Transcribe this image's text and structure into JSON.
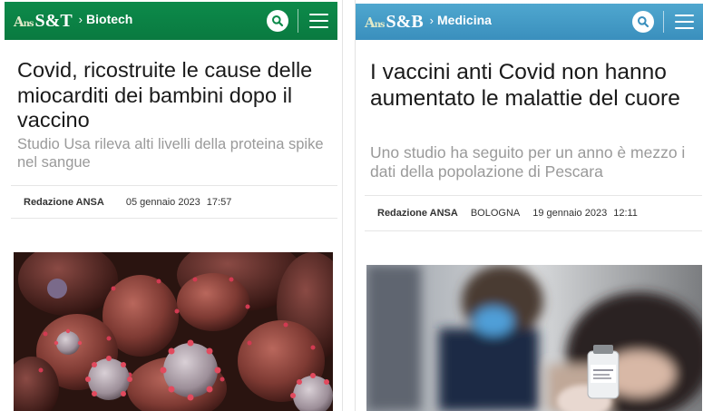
{
  "articles": [
    {
      "logo_mark": "ANSA",
      "logo_text": "S&T",
      "section": "Biotech",
      "headline": "Covid, ricostruite le cause delle miocarditi dei bambini dopo il vaccino",
      "subtitle": "Studio Usa rileva alti livelli della proteina spike nel sangue",
      "author": "Redazione ANSA",
      "location": "",
      "date": "05 gennaio 2023",
      "time": "17:57",
      "header_color": "#0c8a4a",
      "image_icon": "coronavirus-microscopy-image"
    },
    {
      "logo_mark": "ANSA",
      "logo_text": "S&B",
      "section": "Medicina",
      "headline": "I vaccini anti Covid non hanno aumentato le malattie del cuore",
      "subtitle": "Uno studio ha seguito per un anno è mezzo i dati della popolazione di Pescara",
      "author": "Redazione ANSA",
      "location": "BOLOGNA",
      "date": "19 gennaio 2023",
      "time": "12:11",
      "header_color": "#4fa7cf",
      "image_icon": "vaccine-vial-photo"
    }
  ],
  "icons": {
    "search": "search-icon",
    "menu": "hamburger-menu-icon",
    "breadcrumb": "chevron-right-icon"
  }
}
